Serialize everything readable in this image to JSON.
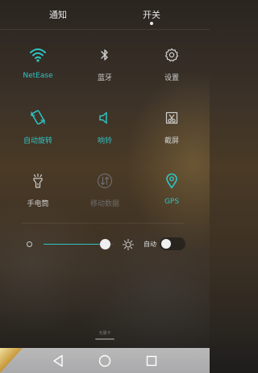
{
  "header": {
    "tabs": [
      {
        "label": "通知",
        "active": false
      },
      {
        "label": "开关",
        "active": true
      }
    ]
  },
  "tiles": [
    {
      "label": "NetEase",
      "icon": "wifi-icon",
      "state": "on"
    },
    {
      "label": "蓝牙",
      "icon": "bluetooth-icon",
      "state": "off"
    },
    {
      "label": "设置",
      "icon": "gear-icon",
      "state": "off"
    },
    {
      "label": "自动旋转",
      "icon": "auto-rotate-icon",
      "state": "on"
    },
    {
      "label": "响铃",
      "icon": "speaker-icon",
      "state": "on"
    },
    {
      "label": "截屏",
      "icon": "screenshot-icon",
      "state": "off"
    },
    {
      "label": "手电筒",
      "icon": "flashlight-icon",
      "state": "off"
    },
    {
      "label": "移动数据",
      "icon": "mobile-data-icon",
      "state": "disabled"
    },
    {
      "label": "GPS",
      "icon": "location-pin-icon",
      "state": "on"
    }
  ],
  "brightness": {
    "level": 0.88,
    "auto_label": "自动",
    "auto_enabled": false
  },
  "sim_label": "无服卡",
  "colors": {
    "accent": "#2ec4c4",
    "label_default": "#cfcfcf",
    "label_disabled": "#6d6d6d",
    "navbar": "#b3b3b4"
  }
}
